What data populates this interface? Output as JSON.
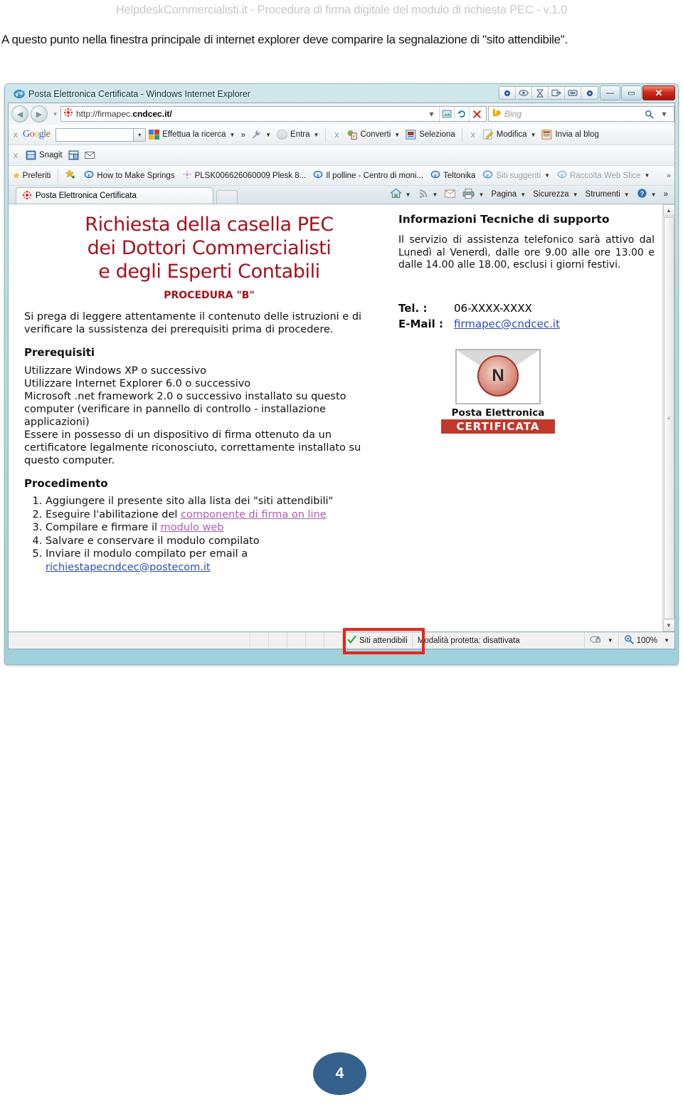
{
  "document": {
    "header": "HelpdeskCommercialisti.it - Procedura di firma digitale del modulo di richiesta PEC - v.1.0",
    "intro": "A questo punto nella finestra principale di internet explorer deve comparire la segnalazione di \"sito attendibile\".",
    "page_number": "4"
  },
  "browser": {
    "title": "Posta Elettronica Certificata - Windows Internet Explorer",
    "caption_buttons": {
      "minimize": "—",
      "maximize": "▭",
      "close": "✕"
    },
    "extra_toolbar_buttons": [
      "rec-icon",
      "eye-icon",
      "hourglass-icon",
      "exit-icon",
      "window-icon",
      "dot-icon"
    ],
    "nav": {
      "back": "◀",
      "forward": "▶",
      "recent_pages": "▾",
      "url": "http://firmapec.",
      "url_domain": "cndcec.it/",
      "compat_view": "compatibility-icon",
      "refresh": "↻",
      "stop": "✕",
      "search_placeholder": "Bing",
      "search_go": "⌕",
      "search_drop": "▾"
    },
    "toolbar_google": {
      "close": "x",
      "brand": "Google",
      "input_value": "",
      "dropdown": "▾",
      "search_button": "Effettua la ricerca",
      "overflow": "»",
      "tools": "wrench-icon",
      "signin": "Entra"
    },
    "toolbar_nuance": {
      "close": "x",
      "convert": "Converti",
      "select": "Seleziona"
    },
    "toolbar_live": {
      "close": "x",
      "edit": "Modifica",
      "blog": "Invia al blog"
    },
    "toolbar_snagit": {
      "close": "x",
      "label": "Snagit",
      "buttons": [
        "capture-icon",
        "mail-icon"
      ]
    },
    "favorites": {
      "label": "Preferiti",
      "add_icon": "add-favorite-icon",
      "items": [
        {
          "label": "How to Make Springs",
          "icon": "ie-page-icon",
          "dim": false
        },
        {
          "label": "PLSK006626060009 Plesk 8...",
          "icon": "plesk-icon",
          "dim": false
        },
        {
          "label": "Il polline - Centro di moni...",
          "icon": "ie-page-icon",
          "dim": false
        },
        {
          "label": "Teltonika",
          "icon": "ie-page-icon",
          "dim": false
        },
        {
          "label": "Siti suggeriti",
          "icon": "ie-icon",
          "dim": true,
          "caret": "▾"
        },
        {
          "label": "Raccolta Web Slice",
          "icon": "ie-page-icon",
          "dim": true,
          "caret": "▾"
        }
      ],
      "overflow": "»"
    },
    "tab": {
      "label": "Posta Elettronica Certificata",
      "favicon": "pec-favicon"
    },
    "commandbar": {
      "home": "home-icon",
      "feeds": "feed-icon",
      "read_mail": "mail-icon",
      "print": "print-icon",
      "items": [
        "Pagina",
        "Sicurezza",
        "Strumenti"
      ],
      "help": "help-icon",
      "overflow": "»"
    },
    "statusbar": {
      "zone_icon": "check-icon",
      "zone": "Siti attendibili",
      "protected_mode": "Modalità protetta: disattivata",
      "zoom_icon": "zoom-icon",
      "zoom": "100%",
      "privacy_icon": "privacy-icon"
    },
    "scrollbar": {
      "up": "▲",
      "down": "▼",
      "grip": "≡"
    }
  },
  "page": {
    "title_lines": [
      "Richiesta della casella PEC",
      "dei Dottori Commercialisti",
      "e degli Esperti Contabili"
    ],
    "subtitle": "PROCEDURA \"B\"",
    "intro": "Si prega di leggere attentamente il contenuto delle istruzioni e di verificare la sussistenza dei prerequisiti prima di procedere.",
    "prereq_heading": "Prerequisiti",
    "prereq_items": [
      "Utilizzare Windows XP o successivo",
      "Utilizzare Internet Explorer 6.0 o successivo",
      "Microsoft .net framework 2.0 o successivo installato su questo computer (verificare in pannello di controllo - installazione applicazioni)",
      "Essere in possesso di un dispositivo di firma ottenuto da un certificatore legalmente riconosciuto, correttamente installato su questo computer."
    ],
    "proc_heading": "Procedimento",
    "proc_items": [
      {
        "pre": "Aggiungere il presente sito alla lista dei \"siti attendibili\"",
        "link": "",
        "post": ""
      },
      {
        "pre": "Eseguire l'abilitazione del ",
        "link": "componente di firma on line",
        "link_style": "pink",
        "post": ""
      },
      {
        "pre": "Compilare e firmare il ",
        "link": "modulo web",
        "link_style": "pink",
        "post": ""
      },
      {
        "pre": "Salvare e conservare il modulo compilato",
        "link": "",
        "post": ""
      },
      {
        "pre": "Inviare il modulo compilato per email a ",
        "link": "richiestapecndcec@postecom.it",
        "link_style": "blue",
        "post": ""
      }
    ],
    "support": {
      "heading": "Informazioni Tecniche di supporto",
      "body": "Il servizio di assistenza telefonico sarà attivo dal Lunedì al Venerdì, dalle ore 9.00 alle ore 13.00 e dalle 14.00 alle 18.00, esclusi i giorni festivi.",
      "tel_label": "Tel. :",
      "tel_value": "06-XXXX-XXXX",
      "email_label": "E-Mail :",
      "email_value": "firmapec@cndcec.it"
    },
    "pec_logo": {
      "line1": "Posta Elettronica",
      "line2": "CERTIFICATA",
      "seal": "N"
    }
  },
  "colors": {
    "page_title": "#a3121d",
    "badge": "#35618f",
    "highlight_box": "#e8241b",
    "link_pink": "#b05cb0",
    "link_blue": "#2a4db8"
  }
}
